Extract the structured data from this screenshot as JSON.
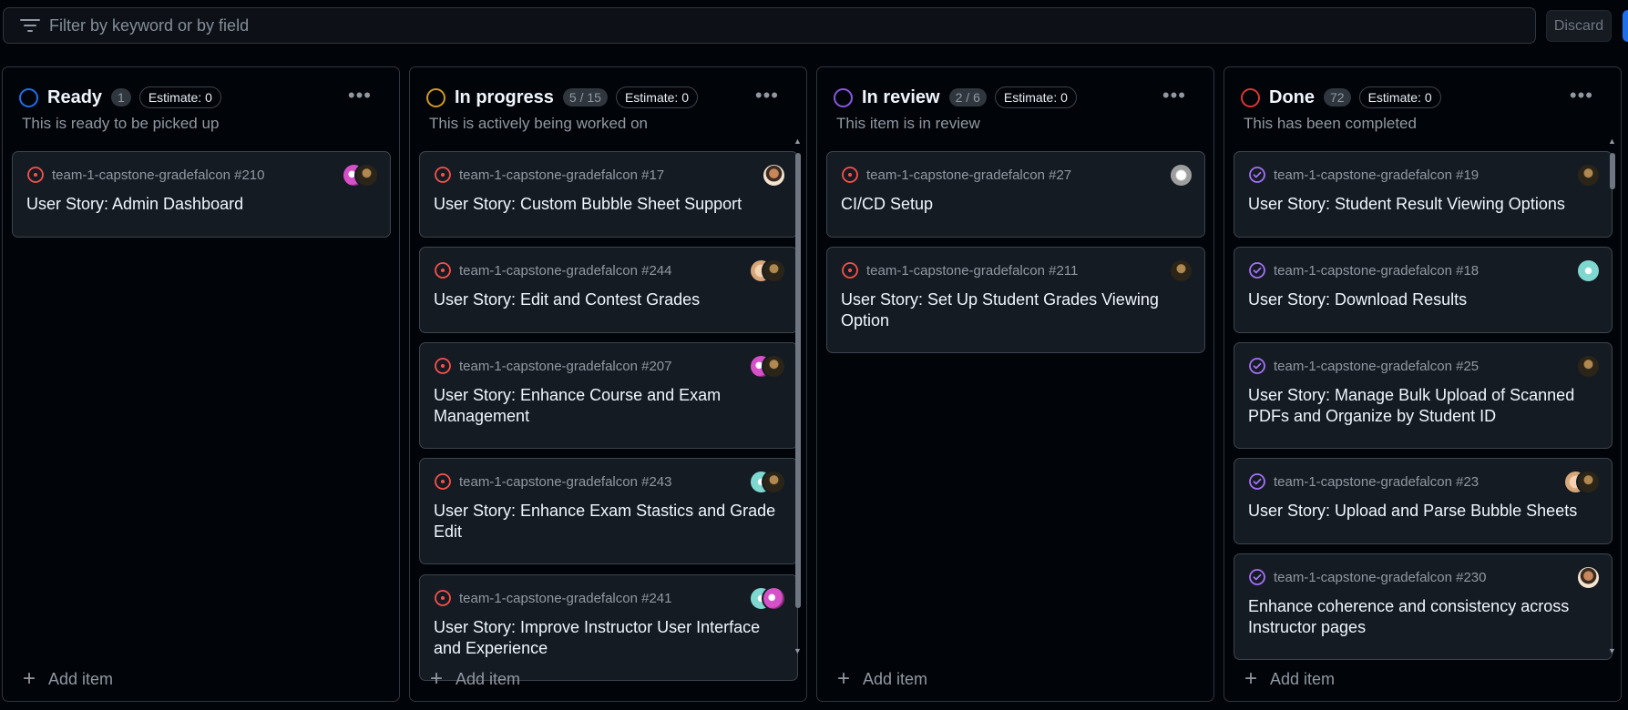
{
  "filter": {
    "placeholder": "Filter by keyword or by field",
    "discard_label": "Discard"
  },
  "colors": {
    "blue": "#1f6feb",
    "orange": "#d29922",
    "purple": "#8957e5",
    "red": "#da3633",
    "issue_open": "#f85149",
    "issue_done": "#a371f7"
  },
  "columns": [
    {
      "title": "Ready",
      "count": "1",
      "estimate": "Estimate: 0",
      "description": "This is ready to be picked up",
      "ring_color": "#1f6feb",
      "add_label": "Add item",
      "cards": [
        {
          "repo": "team-1-capstone-gradefalcon #210",
          "title": "User Story: Admin Dashboard",
          "state": "open",
          "avatars": [
            "pink",
            "dark"
          ]
        }
      ]
    },
    {
      "title": "In progress",
      "count": "5 / 15",
      "estimate": "Estimate: 0",
      "description": "This is actively being worked on",
      "ring_color": "#d29922",
      "add_label": "Add item",
      "cards": [
        {
          "repo": "team-1-capstone-gradefalcon #17",
          "title": "User Story: Custom Bubble Sheet Support",
          "state": "open",
          "avatars": [
            "face"
          ]
        },
        {
          "repo": "team-1-capstone-gradefalcon #244",
          "title": "User Story: Edit and Contest Grades",
          "state": "open",
          "avatars": [
            "beige",
            "dark"
          ]
        },
        {
          "repo": "team-1-capstone-gradefalcon #207",
          "title": "User Story: Enhance Course and Exam Management",
          "state": "open",
          "avatars": [
            "pink",
            "dark"
          ]
        },
        {
          "repo": "team-1-capstone-gradefalcon #243",
          "title": "User Story: Enhance Exam Stastics and Grade Edit",
          "state": "open",
          "avatars": [
            "mint",
            "dark"
          ]
        },
        {
          "repo": "team-1-capstone-gradefalcon #241",
          "title": "User Story: Improve Instructor User Interface and Experience",
          "state": "open",
          "avatars": [
            "mint",
            "pink"
          ]
        }
      ]
    },
    {
      "title": "In review",
      "count": "2 / 6",
      "estimate": "Estimate: 0",
      "description": "This item is in review",
      "ring_color": "#8957e5",
      "add_label": "Add item",
      "cards": [
        {
          "repo": "team-1-capstone-gradefalcon #27",
          "title": "CI/CD Setup",
          "state": "open",
          "avatars": [
            "grey"
          ]
        },
        {
          "repo": "team-1-capstone-gradefalcon #211",
          "title": "User Story: Set Up Student Grades Viewing Option",
          "state": "open",
          "avatars": [
            "dark"
          ]
        }
      ]
    },
    {
      "title": "Done",
      "count": "72",
      "estimate": "Estimate: 0",
      "description": "This has been completed",
      "ring_color": "#da3633",
      "add_label": "Add item",
      "cards": [
        {
          "repo": "team-1-capstone-gradefalcon #19",
          "title": "User Story: Student Result Viewing Options",
          "state": "done",
          "avatars": [
            "dark"
          ]
        },
        {
          "repo": "team-1-capstone-gradefalcon #18",
          "title": "User Story: Download Results",
          "state": "done",
          "avatars": [
            "mint"
          ]
        },
        {
          "repo": "team-1-capstone-gradefalcon #25",
          "title": "User Story: Manage Bulk Upload of Scanned PDFs and Organize by Student ID",
          "state": "done",
          "avatars": [
            "dark"
          ]
        },
        {
          "repo": "team-1-capstone-gradefalcon #23",
          "title": "User Story: Upload and Parse Bubble Sheets",
          "state": "done",
          "avatars": [
            "beige",
            "dark"
          ]
        },
        {
          "repo": "team-1-capstone-gradefalcon #230",
          "title": "Enhance coherence and consistency across Instructor pages",
          "state": "done",
          "avatars": [
            "face"
          ]
        }
      ]
    }
  ]
}
